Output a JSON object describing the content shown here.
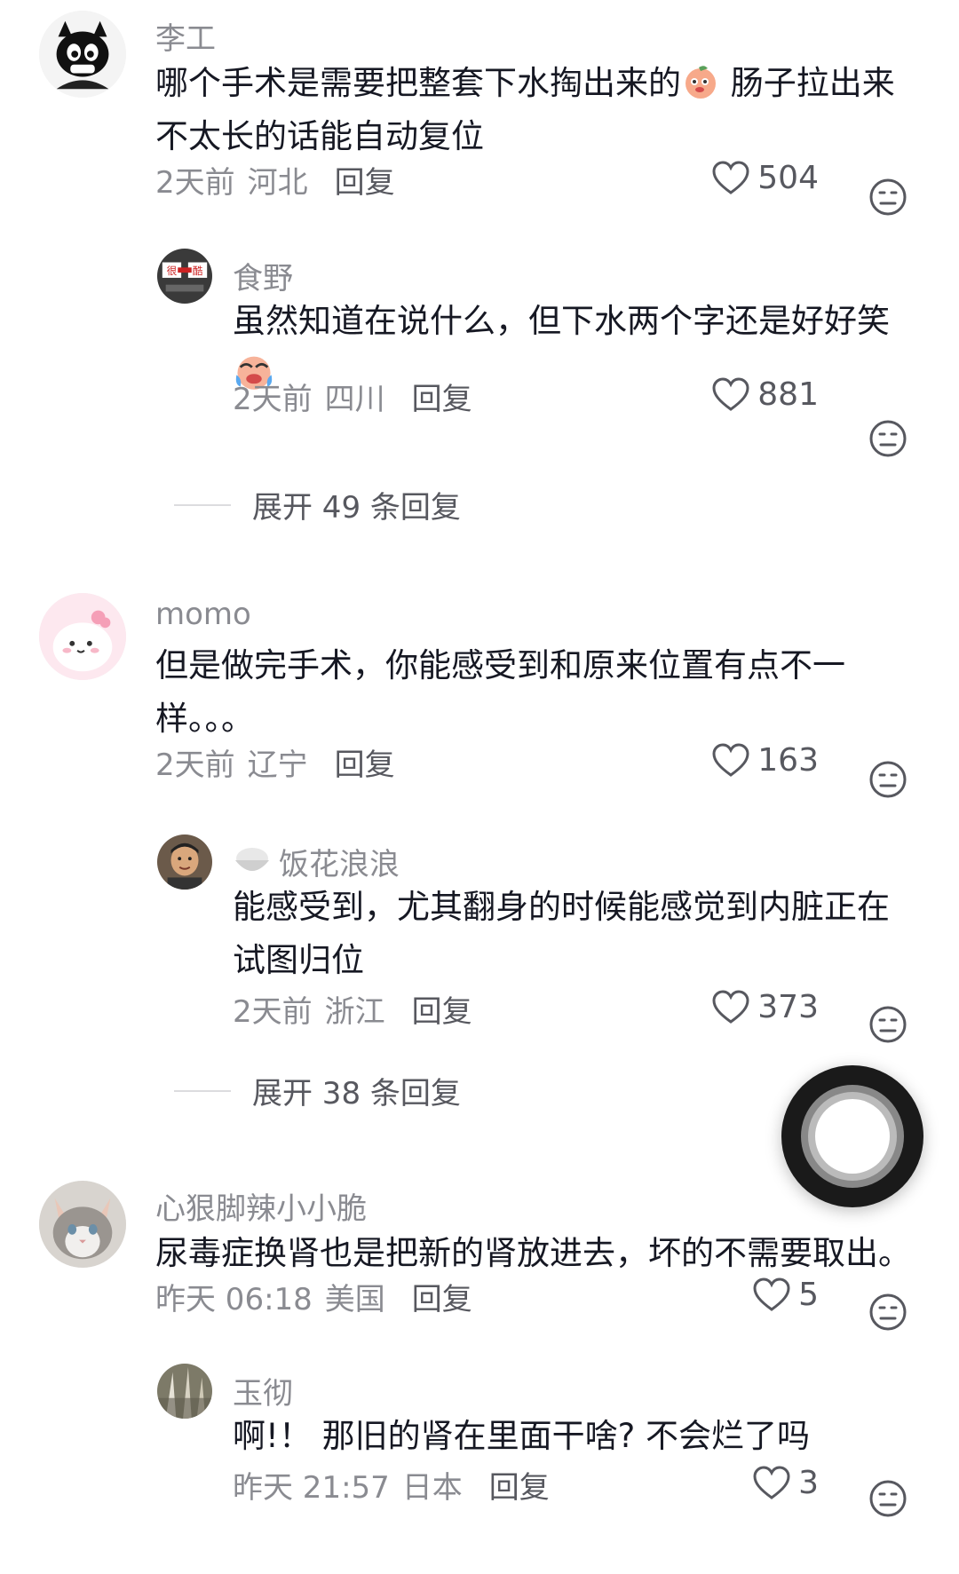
{
  "comments": [
    {
      "user": "李工",
      "text_a": "哪个手术是需要把整套下水掏出来的",
      "text_b": " 肠子拉出来\n不太长的话能自动复位",
      "time": "2天前",
      "location": "河北",
      "reply_label": "回复",
      "likes": "504",
      "replies": [
        {
          "user": "食野",
          "avatar_text_a": "很",
          "avatar_text_b": "酷",
          "text": "虽然知道在说什么，但下水两个字还是好好笑",
          "time": "2天前",
          "location": "四川",
          "reply_label": "回复",
          "likes": "881"
        }
      ],
      "expand_label": "展开 49 条回复"
    },
    {
      "user": "momo",
      "text": "但是做完手术，你能感受到和原来位置有点不一\n样。。。",
      "time": "2天前",
      "location": "辽宁",
      "reply_label": "回复",
      "likes": "163",
      "replies": [
        {
          "user": "饭花浪浪",
          "text": "能感受到，尤其翻身的时候能感觉到内脏正在\n试图归位",
          "time": "2天前",
          "location": "浙江",
          "reply_label": "回复",
          "likes": "373"
        }
      ],
      "expand_label": "展开 38 条回复"
    },
    {
      "user": "心狠脚辣小小脆",
      "text": "尿毒症换肾也是把新的肾放进去，坏的不需要取出。",
      "time": "昨天 06:18",
      "location": "美国",
      "reply_label": "回复",
      "likes": "5",
      "replies": [
        {
          "user": "玉彻",
          "text": "啊!！ 那旧的肾在里面干啥? 不会烂了吗",
          "time": "昨天 21:57",
          "location": "日本",
          "reply_label": "回复",
          "likes": "3"
        }
      ]
    }
  ],
  "icons": {
    "like": "heart-outline-icon",
    "dislike": "neutral-face-icon",
    "floating": "record-button-icon"
  }
}
